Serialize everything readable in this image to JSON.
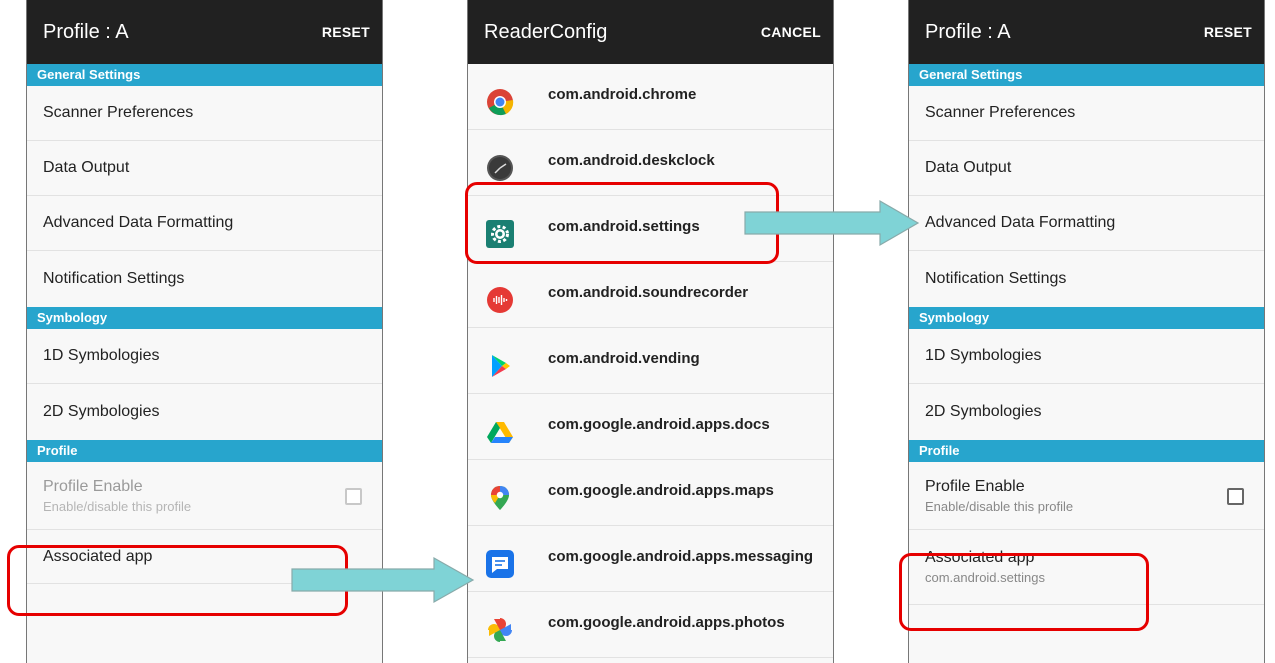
{
  "left_screen": {
    "title": "Profile : A",
    "action": "RESET",
    "sections": {
      "general": "General Settings",
      "symbology": "Symbology",
      "profile": "Profile"
    },
    "items": {
      "scanner_preferences": "Scanner Preferences",
      "data_output": "Data Output",
      "advanced_data_formatting": "Advanced Data Formatting",
      "notification_settings": "Notification Settings",
      "symbologies_1d": "1D Symbologies",
      "symbologies_2d": "2D Symbologies",
      "profile_enable": "Profile Enable",
      "profile_enable_sub": "Enable/disable this profile",
      "associated_app": "Associated app"
    }
  },
  "middle_screen": {
    "title": "ReaderConfig",
    "action": "CANCEL",
    "apps": [
      {
        "label": "com.android.chrome",
        "icon": "chrome-icon"
      },
      {
        "label": "com.android.deskclock",
        "icon": "clock-icon"
      },
      {
        "label": "com.android.settings",
        "icon": "settings-gear-icon"
      },
      {
        "label": "com.android.soundrecorder",
        "icon": "sound-recorder-icon"
      },
      {
        "label": "com.android.vending",
        "icon": "play-store-icon"
      },
      {
        "label": "com.google.android.apps.docs",
        "icon": "google-drive-icon"
      },
      {
        "label": "com.google.android.apps.maps",
        "icon": "google-maps-icon"
      },
      {
        "label": "com.google.android.apps.messaging",
        "icon": "messages-icon"
      },
      {
        "label": "com.google.android.apps.photos",
        "icon": "google-photos-icon"
      }
    ]
  },
  "right_screen": {
    "title": "Profile : A",
    "action": "RESET",
    "sections": {
      "general": "General Settings",
      "symbology": "Symbology",
      "profile": "Profile"
    },
    "items": {
      "scanner_preferences": "Scanner Preferences",
      "data_output": "Data Output",
      "advanced_data_formatting": "Advanced Data Formatting",
      "notification_settings": "Notification Settings",
      "symbologies_1d": "1D Symbologies",
      "symbologies_2d": "2D Symbologies",
      "profile_enable": "Profile Enable",
      "profile_enable_sub": "Enable/disable this profile",
      "associated_app": "Associated app",
      "associated_app_sub": "com.android.settings"
    }
  },
  "colors": {
    "appbar": "#212121",
    "section_header": "#27a5cd",
    "highlight": "#e60000",
    "arrow": "#7fd3d6"
  }
}
